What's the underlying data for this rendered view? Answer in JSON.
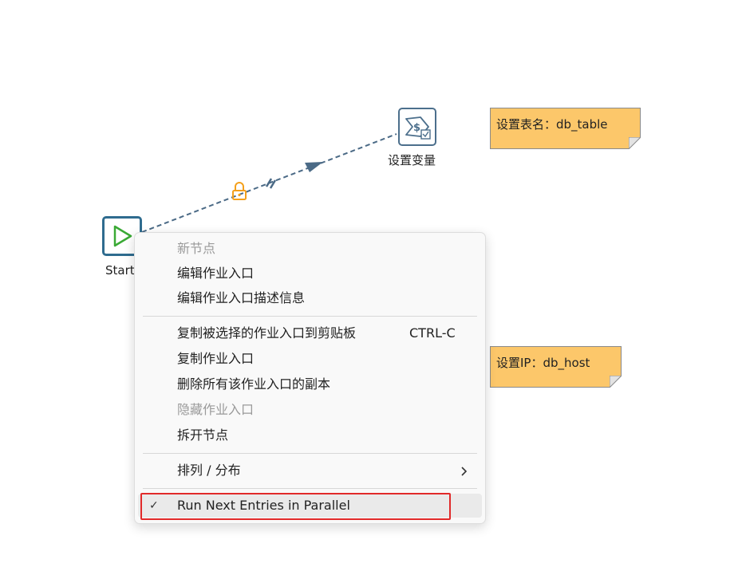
{
  "canvas": {
    "nodes": {
      "start": {
        "label": "Start",
        "icon": "play-icon"
      },
      "set_variables": {
        "label": "设置变量",
        "icon": "set-variables-icon"
      }
    },
    "hop": {
      "locked_icon": "lock-icon",
      "parallel_icon": "parallel-marker-icon"
    },
    "notes": [
      {
        "text": "设置表名：db_table"
      },
      {
        "text": "设置IP：db_host"
      }
    ]
  },
  "context_menu": {
    "group1": [
      {
        "label": "新节点",
        "disabled": true
      },
      {
        "label": "编辑作业入口",
        "disabled": false
      },
      {
        "label": "编辑作业入口描述信息",
        "disabled": false
      }
    ],
    "group2": [
      {
        "label": "复制被选择的作业入口到剪贴板",
        "shortcut": "CTRL-C",
        "disabled": false
      },
      {
        "label": "复制作业入口",
        "disabled": false
      },
      {
        "label": "删除所有该作业入口的副本",
        "disabled": false
      },
      {
        "label": "隐藏作业入口",
        "disabled": true
      },
      {
        "label": "拆开节点",
        "disabled": false
      }
    ],
    "group3": [
      {
        "label": "排列 / 分布",
        "submenu_icon": "chevron-right-icon"
      }
    ],
    "group4": [
      {
        "label": "Run Next Entries in Parallel",
        "checked": true,
        "check_glyph": "✓"
      }
    ]
  },
  "colors": {
    "note_bg": "#fcc76a",
    "hop": "#4b6a86",
    "lock": "#f4a01c",
    "start_play": "#3aa935",
    "highlight_box": "#e12a2a"
  }
}
